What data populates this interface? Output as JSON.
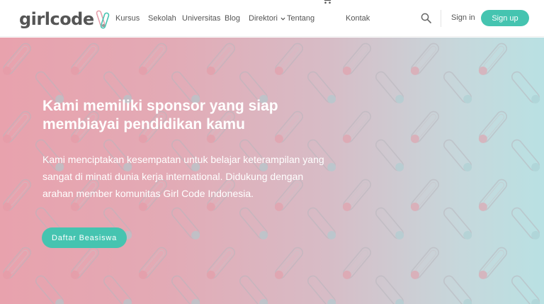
{
  "brand": {
    "logo_text": "girlcode",
    "accent": "#45c4b0",
    "text_color": "#555555"
  },
  "nav": {
    "items": [
      {
        "label": "Kursus"
      },
      {
        "label": "Sekolah"
      },
      {
        "label": "Universitas"
      },
      {
        "label": "Blog"
      },
      {
        "label": "Direktori",
        "icon": "chevron-down-icon"
      },
      {
        "label": "Tentang"
      },
      {
        "icon": "cart-icon"
      },
      {
        "label": "Kontak"
      }
    ]
  },
  "header_actions": {
    "search_icon": "search-icon",
    "signin_label": "Sign in",
    "signup_label": "Sign up"
  },
  "hero": {
    "title": "Kami memiliki sponsor yang siap membiayai pendidikan kamu",
    "description": "Kami menciptakan kesempatan untuk belajar keterampilan yang sangat di minati dunia kerja international. Didukung dengan arahan member komunitas Girl Code Indonesia.",
    "cta_label": "Daftar Beasiswa",
    "gradient_from": "#e8a2ad",
    "gradient_to": "#b9e1e3"
  }
}
